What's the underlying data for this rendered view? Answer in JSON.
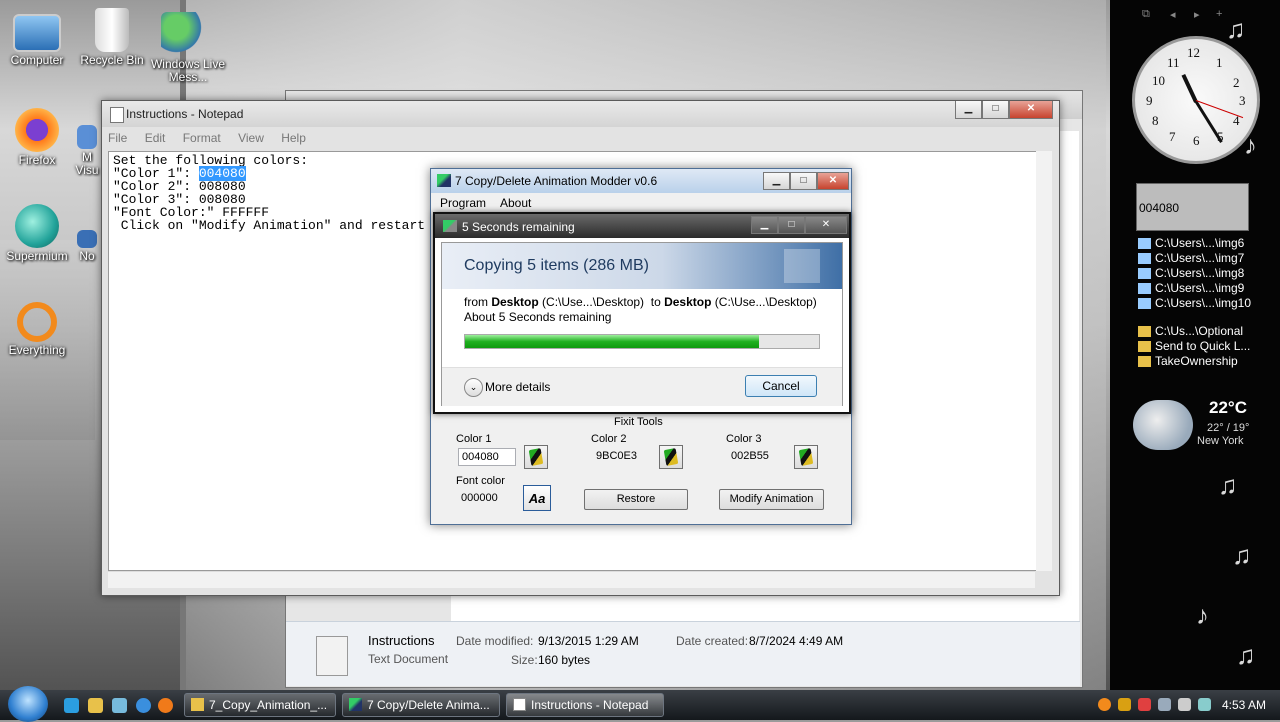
{
  "desktop": {
    "icons": [
      {
        "label": "Computer"
      },
      {
        "label": "Recycle Bin"
      },
      {
        "label": "Windows Live Mess..."
      },
      {
        "label": "Firefox"
      },
      {
        "label": "M Visu"
      },
      {
        "label": "Supermium"
      },
      {
        "label": "No"
      },
      {
        "label": "Everything"
      }
    ]
  },
  "explorer": {
    "details": {
      "name": "Instructions",
      "type": "Text Document",
      "date_modified_label": "Date modified:",
      "date_modified": "9/13/2015 1:29 AM",
      "date_created_label": "Date created:",
      "date_created": "8/7/2024 4:49 AM",
      "size_label": "Size:",
      "size": "160 bytes"
    }
  },
  "notepad": {
    "title": "Instructions - Notepad",
    "menu": [
      "File",
      "Edit",
      "Format",
      "View",
      "Help"
    ],
    "lines": {
      "l1": "Set the following colors:",
      "l2_pre": "\"Color 1\": ",
      "l2_sel": "004080",
      "l3": "\"Color 2\": 008080",
      "l4": "\"Color 3\": 008080",
      "l5": "\"Font Color:\" FFFFFF",
      "l6": " Click on \"Modify Animation\" and restart"
    }
  },
  "modder": {
    "title": "7 Copy/Delete Animation Modder v0.6",
    "menu": [
      "Program",
      "About"
    ],
    "fixit_label": "Fixit Tools",
    "color1_label": "Color 1",
    "color1_value": "004080",
    "color2_label": "Color 2",
    "color2_value": "9BC0E3",
    "color3_label": "Color 3",
    "color3_value": "002B55",
    "font_label": "Font color",
    "font_value": "000000",
    "font_button": "Aa",
    "restore_label": "Restore",
    "modify_label": "Modify Animation"
  },
  "copy_dialog": {
    "title": "5 Seconds remaining",
    "heading": "Copying 5 items (286 MB)",
    "from_word": "from",
    "from_name": "Desktop",
    "from_path": "(C:\\Use...\\Desktop)",
    "to_word": "to",
    "to_name": "Desktop",
    "to_path": "(C:\\Use...\\Desktop)",
    "remaining": "About 5 Seconds remaining",
    "progress": 0.83,
    "more_details": "More details",
    "cancel_label": "Cancel"
  },
  "sidebar": {
    "clipboard_value": "004080",
    "files": [
      "C:\\Users\\...\\img6",
      "C:\\Users\\...\\img7",
      "C:\\Users\\...\\img8",
      "C:\\Users\\...\\img9",
      "C:\\Users\\...\\img10"
    ],
    "folders": [
      "C:\\Us...\\Optional",
      "Send to Quick L...",
      "TakeOwnership"
    ],
    "weather": {
      "temp": "22°C",
      "range": "22° / 19°",
      "city": "New York"
    }
  },
  "taskbar": {
    "buttons": [
      "7_Copy_Animation_...",
      "7 Copy/Delete Anima...",
      "Instructions - Notepad"
    ],
    "clock": "4:53 AM"
  }
}
